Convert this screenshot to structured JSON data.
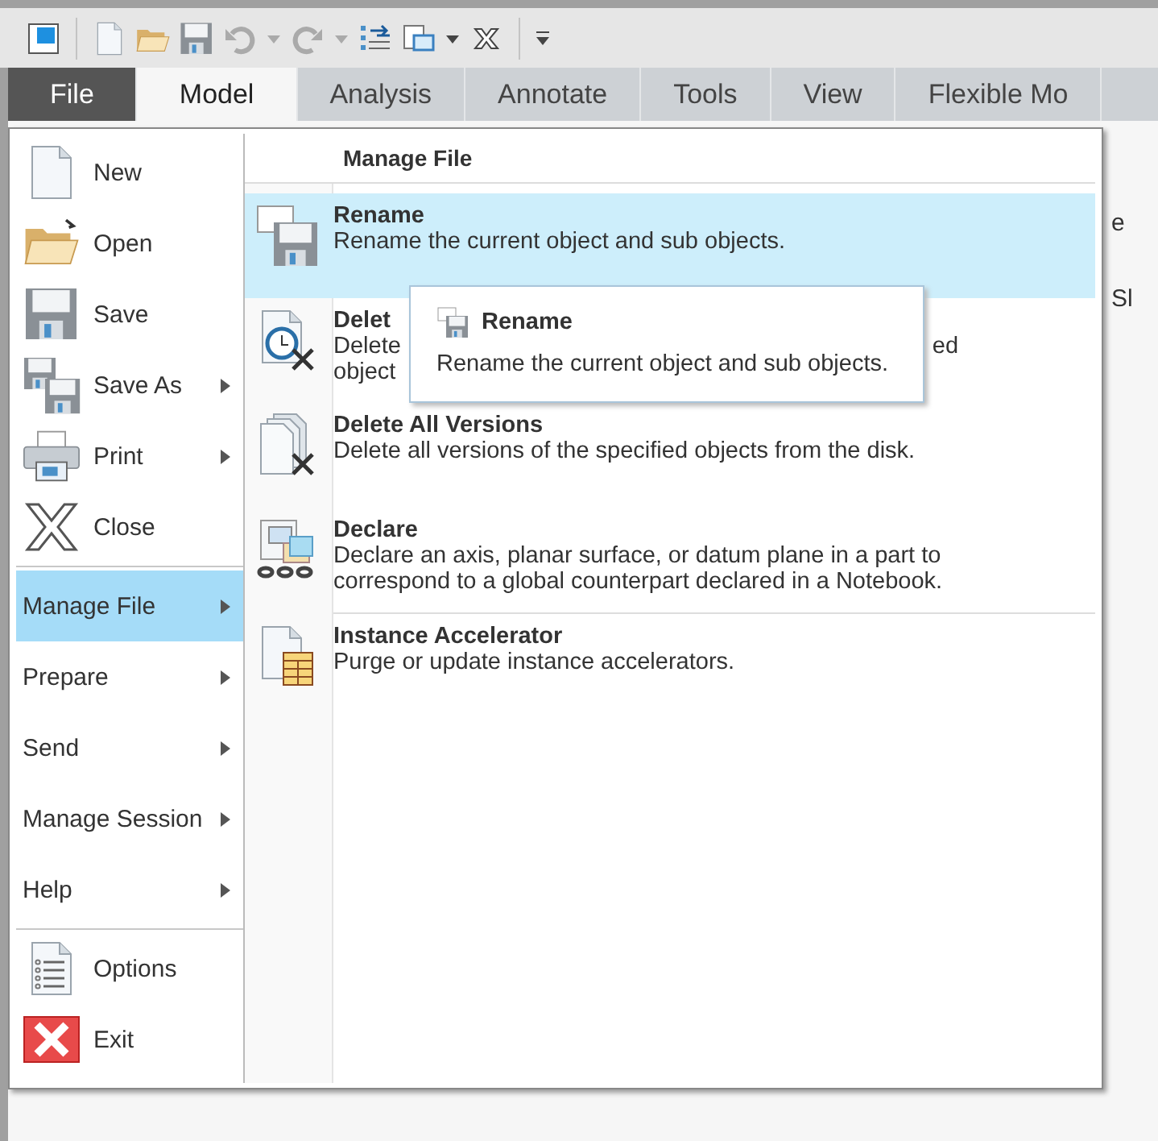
{
  "ribbon_tabs": [
    {
      "label": "File",
      "kind": "file",
      "selected": false
    },
    {
      "label": "Model",
      "kind": "tab",
      "selected": true
    },
    {
      "label": "Analysis",
      "kind": "tab",
      "selected": false
    },
    {
      "label": "Annotate",
      "kind": "tab",
      "selected": false
    },
    {
      "label": "Tools",
      "kind": "tab",
      "selected": false
    },
    {
      "label": "View",
      "kind": "tab",
      "selected": false
    },
    {
      "label": "Flexible Mo",
      "kind": "tab",
      "selected": false
    }
  ],
  "file_menu": {
    "groups": [
      [
        {
          "label": "New",
          "kind": "new",
          "submenu": false,
          "selected": false
        },
        {
          "label": "Open",
          "kind": "open",
          "submenu": false,
          "selected": false
        },
        {
          "label": "Save",
          "kind": "save",
          "submenu": false,
          "selected": false
        },
        {
          "label": "Save As",
          "kind": "save-as",
          "submenu": true,
          "selected": false
        },
        {
          "label": "Print",
          "kind": "print",
          "submenu": true,
          "selected": false
        },
        {
          "label": "Close",
          "kind": "close",
          "submenu": false,
          "selected": false
        }
      ],
      [
        {
          "label": "Manage File",
          "kind": "text",
          "submenu": true,
          "selected": true
        },
        {
          "label": "Prepare",
          "kind": "text",
          "submenu": true,
          "selected": false
        },
        {
          "label": "Send",
          "kind": "text",
          "submenu": true,
          "selected": false
        },
        {
          "label": "Manage Session",
          "kind": "text",
          "submenu": true,
          "selected": false
        },
        {
          "label": "Help",
          "kind": "text",
          "submenu": true,
          "selected": false
        }
      ],
      [
        {
          "label": "Options",
          "kind": "options",
          "submenu": false,
          "selected": false
        },
        {
          "label": "Exit",
          "kind": "exit",
          "submenu": false,
          "selected": false
        }
      ]
    ]
  },
  "submenu": {
    "title": "Manage File",
    "items": [
      {
        "title": "Rename",
        "kind": "rename",
        "selected": true,
        "separator_before": false,
        "description": [
          "Rename the current object and sub objects."
        ]
      },
      {
        "title": "Delet",
        "kind": "delete-old",
        "selected": false,
        "separator_before": false,
        "description": [
          "Delete",
          "object"
        ],
        "trailing": "ed"
      },
      {
        "title": "Delete All Versions",
        "kind": "delete-all",
        "selected": false,
        "separator_before": false,
        "description": [
          "Delete all versions of the specified objects from the disk."
        ]
      },
      {
        "title": "Declare",
        "kind": "declare",
        "selected": false,
        "separator_before": false,
        "description": [
          "Declare an axis, planar surface, or datum plane in a part to",
          "correspond to a global counterpart declared in a Notebook."
        ]
      },
      {
        "title": "Instance Accelerator",
        "kind": "instance",
        "selected": false,
        "separator_before": true,
        "description": [
          "Purge or update instance accelerators."
        ]
      }
    ]
  },
  "tooltip": {
    "title": "Rename",
    "description": "Rename the current object and sub objects."
  },
  "background": {
    "texts": [
      "e",
      "Sl"
    ]
  }
}
